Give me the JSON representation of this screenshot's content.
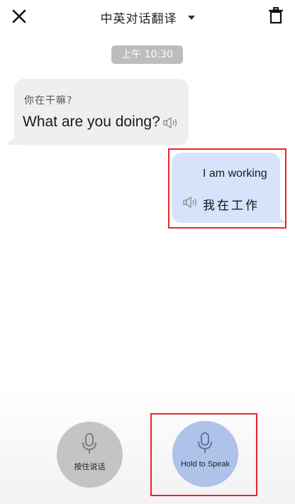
{
  "header": {
    "title": "中英对话翻译",
    "close_icon": "close-icon",
    "dropdown_icon": "caret-down-icon",
    "trash_icon": "trash-icon"
  },
  "conversation": {
    "timestamp": "上午 10:30",
    "messages": [
      {
        "side": "left",
        "source_text": "你在干嘛?",
        "translated_text": "What are you doing?",
        "speaker_icon": "speaker-icon",
        "bubble_color": "#efefef"
      },
      {
        "side": "right",
        "source_text": "I am working",
        "translated_text": "我在工作",
        "speaker_icon": "speaker-icon",
        "bubble_color": "#d6e3fb"
      }
    ]
  },
  "controls": {
    "chinese_button_label": "按住说话",
    "english_button_label": "Hold to Speak",
    "mic_icon": "microphone-icon",
    "chinese_button_color": "#c4c4c4",
    "english_button_color": "#aec2ea"
  },
  "highlight_color": "#e8262a"
}
